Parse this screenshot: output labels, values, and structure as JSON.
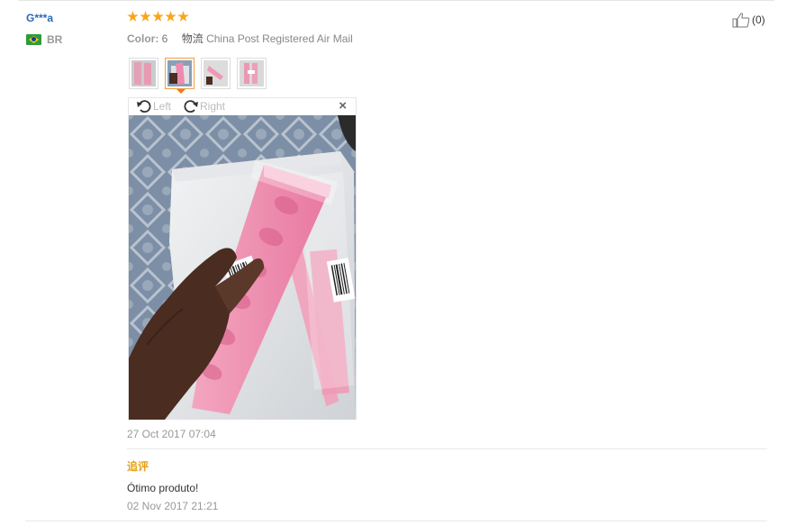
{
  "review": {
    "user_name": "G***a",
    "country_code": "BR",
    "rating_stars": 5,
    "color_label": "Color:",
    "color_value": "6",
    "shipping_label": "物流",
    "shipping_value": "China Post Registered Air Mail",
    "helpful_count": "(0)",
    "photos": {
      "count": 4,
      "selected_index": 1,
      "rotate_left_label": "Left",
      "rotate_right_label": "Right",
      "close_label": "×"
    },
    "date": "27 Oct 2017 07:04"
  },
  "followup": {
    "title": "追评",
    "text": "Ótimo produto!",
    "date": "02 Nov 2017 21:21"
  },
  "colors": {
    "star": "#f7a51c",
    "username": "#2a6ab8",
    "followup_title": "#e4a11b",
    "thumb_active_border": "#f0a040"
  },
  "icons": {
    "helpful": "thumbs-up-icon",
    "rotate_left": "rotate-left-icon",
    "rotate_right": "rotate-right-icon",
    "close": "close-icon",
    "flag": "brazil-flag-icon"
  }
}
